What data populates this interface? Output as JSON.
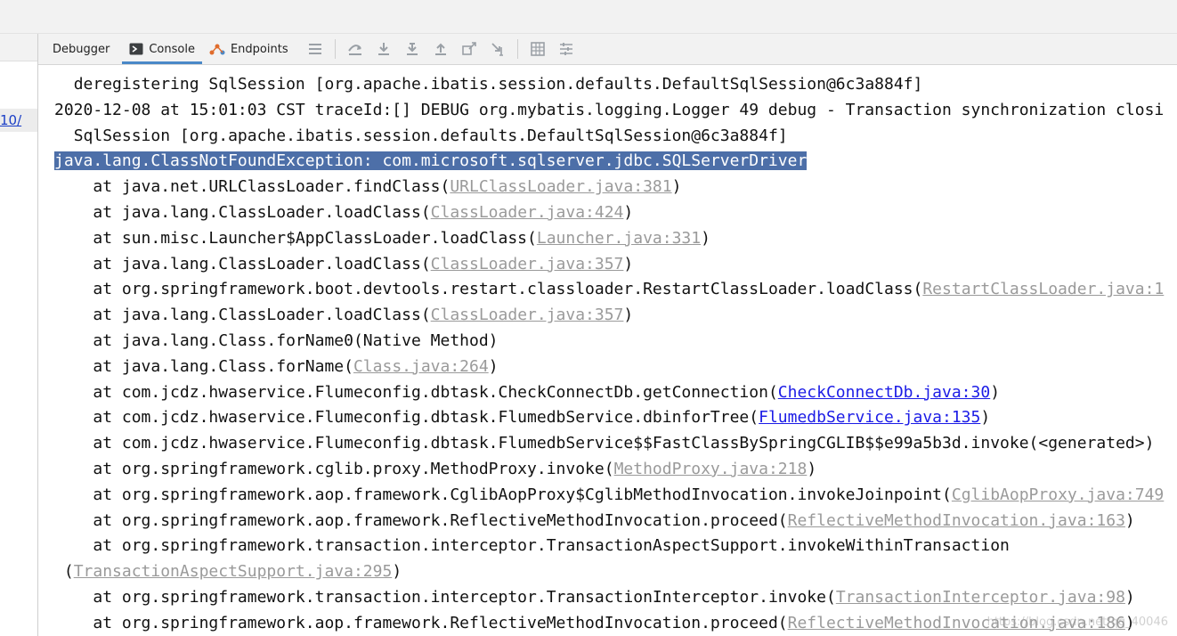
{
  "left_gutter": {
    "link_text": "10/"
  },
  "toolbar": {
    "tabs": [
      {
        "label": "Debugger",
        "icon": "none",
        "active": false
      },
      {
        "label": "Console",
        "icon": "console-icon",
        "active": true
      },
      {
        "label": "Endpoints",
        "icon": "endpoints-icon",
        "active": false
      }
    ],
    "actions": [
      "menu-icon",
      "show-execution-point-icon",
      "step-over-icon",
      "step-into-icon",
      "force-step-into-icon",
      "step-out-icon",
      "drop-frame-icon",
      "run-to-cursor-icon",
      "evaluate-expression-icon",
      "trace-settings-icon"
    ]
  },
  "console": {
    "lines": [
      {
        "indent": "  ",
        "parts": [
          {
            "t": "deregistering SqlSession [org.apache.ibatis.session.defaults.DefaultSqlSession@6c3a884f]"
          }
        ]
      },
      {
        "indent": "",
        "parts": [
          {
            "t": "2020-12-08 at 15:01:03 CST traceId:[] DEBUG org.mybatis.logging.Logger 49 debug - Transaction synchronization closi"
          }
        ]
      },
      {
        "indent": "  ",
        "parts": [
          {
            "t": "SqlSession [org.apache.ibatis.session.defaults.DefaultSqlSession@6c3a884f]"
          }
        ]
      },
      {
        "indent": "",
        "parts": [
          {
            "t": "java.lang.ClassNotFoundException: com.microsoft.sqlserver.jdbc.SQLServerDriver",
            "sel": true
          }
        ]
      },
      {
        "indent": "    ",
        "parts": [
          {
            "t": "at java.net.URLClassLoader.findClass("
          },
          {
            "t": "URLClassLoader.java:381",
            "link": "grey"
          },
          {
            "t": ")"
          }
        ]
      },
      {
        "indent": "    ",
        "parts": [
          {
            "t": "at java.lang.ClassLoader.loadClass("
          },
          {
            "t": "ClassLoader.java:424",
            "link": "grey"
          },
          {
            "t": ")"
          }
        ]
      },
      {
        "indent": "    ",
        "parts": [
          {
            "t": "at sun.misc.Launcher$AppClassLoader.loadClass("
          },
          {
            "t": "Launcher.java:331",
            "link": "grey"
          },
          {
            "t": ")"
          }
        ]
      },
      {
        "indent": "    ",
        "parts": [
          {
            "t": "at java.lang.ClassLoader.loadClass("
          },
          {
            "t": "ClassLoader.java:357",
            "link": "grey"
          },
          {
            "t": ")"
          }
        ]
      },
      {
        "indent": "    ",
        "parts": [
          {
            "t": "at org.springframework.boot.devtools.restart.classloader.RestartClassLoader.loadClass("
          },
          {
            "t": "RestartClassLoader.java:1",
            "link": "grey"
          }
        ]
      },
      {
        "indent": "    ",
        "parts": [
          {
            "t": "at java.lang.ClassLoader.loadClass("
          },
          {
            "t": "ClassLoader.java:357",
            "link": "grey"
          },
          {
            "t": ")"
          }
        ]
      },
      {
        "indent": "    ",
        "parts": [
          {
            "t": "at java.lang.Class.forName0(Native Method)"
          }
        ]
      },
      {
        "indent": "    ",
        "parts": [
          {
            "t": "at java.lang.Class.forName("
          },
          {
            "t": "Class.java:264",
            "link": "grey"
          },
          {
            "t": ")"
          }
        ]
      },
      {
        "indent": "    ",
        "parts": [
          {
            "t": "at com.jcdz.hwaservice.Flumeconfig.dbtask.CheckConnectDb.getConnection("
          },
          {
            "t": "CheckConnectDb.java:30",
            "link": "blue"
          },
          {
            "t": ")"
          }
        ]
      },
      {
        "indent": "    ",
        "parts": [
          {
            "t": "at com.jcdz.hwaservice.Flumeconfig.dbtask.FlumedbService.dbinforTree("
          },
          {
            "t": "FlumedbService.java:135",
            "link": "blue"
          },
          {
            "t": ")"
          }
        ]
      },
      {
        "indent": "    ",
        "parts": [
          {
            "t": "at com.jcdz.hwaservice.Flumeconfig.dbtask.FlumedbService$$FastClassBySpringCGLIB$$e99a5b3d.invoke(<generated>)"
          }
        ]
      },
      {
        "indent": "    ",
        "parts": [
          {
            "t": "at org.springframework.cglib.proxy.MethodProxy.invoke("
          },
          {
            "t": "MethodProxy.java:218",
            "link": "grey"
          },
          {
            "t": ")"
          }
        ]
      },
      {
        "indent": "    ",
        "parts": [
          {
            "t": "at org.springframework.aop.framework.CglibAopProxy$CglibMethodInvocation.invokeJoinpoint("
          },
          {
            "t": "CglibAopProxy.java:749",
            "link": "grey"
          }
        ]
      },
      {
        "indent": "    ",
        "parts": [
          {
            "t": "at org.springframework.aop.framework.ReflectiveMethodInvocation.proceed("
          },
          {
            "t": "ReflectiveMethodInvocation.java:163",
            "link": "grey"
          },
          {
            "t": ")"
          }
        ]
      },
      {
        "indent": "    ",
        "parts": [
          {
            "t": "at org.springframework.transaction.interceptor.TransactionAspectSupport.invokeWithinTransaction"
          }
        ]
      },
      {
        "indent": " ",
        "parts": [
          {
            "t": "("
          },
          {
            "t": "TransactionAspectSupport.java:295",
            "link": "grey"
          },
          {
            "t": ")"
          }
        ]
      },
      {
        "indent": "    ",
        "parts": [
          {
            "t": "at org.springframework.transaction.interceptor.TransactionInterceptor.invoke("
          },
          {
            "t": "TransactionInterceptor.java:98",
            "link": "grey"
          },
          {
            "t": ")"
          }
        ]
      },
      {
        "indent": "    ",
        "parts": [
          {
            "t": "at org.springframework.aop.framework.ReflectiveMethodInvocation.proceed("
          },
          {
            "t": "ReflectiveMethodInvocation.java:186",
            "link": "grey"
          },
          {
            "t": ")"
          }
        ]
      }
    ]
  },
  "watermark": "https://blog.csdn.net/qq_40046"
}
